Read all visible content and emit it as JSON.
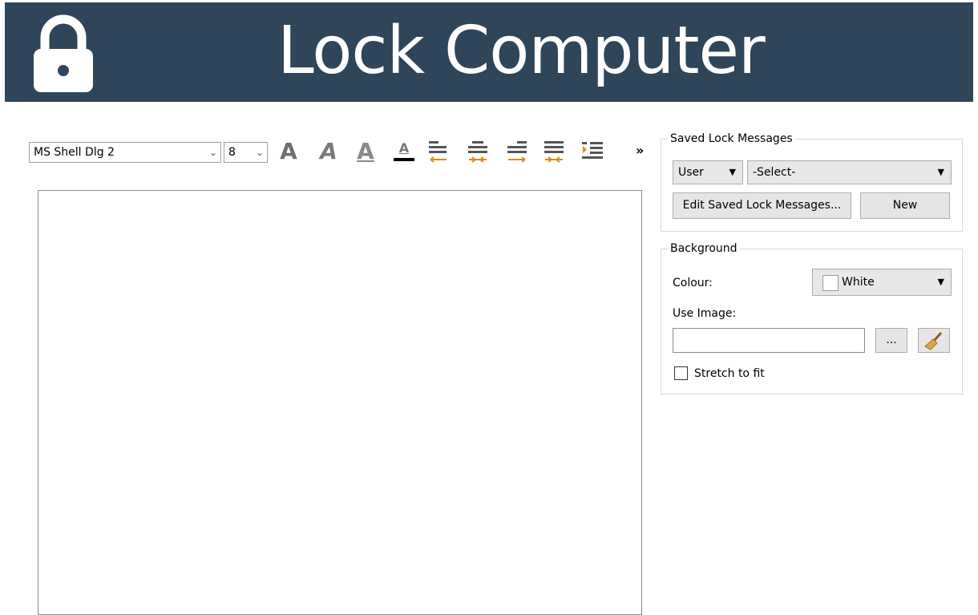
{
  "header": {
    "title": "Lock Computer",
    "icon": "lock-icon",
    "bg_color": "#2e455a"
  },
  "toolbar": {
    "font_family": "MS Shell Dlg 2",
    "font_size": "8",
    "overflow": "»",
    "icons": [
      "bold-icon",
      "italic-icon",
      "underline-icon",
      "font-color-icon",
      "align-left-icon",
      "align-center-icon",
      "align-right-icon",
      "justify-icon",
      "indent-icon"
    ],
    "letter": "A"
  },
  "saved": {
    "title": "Saved Lock Messages",
    "scope": "User",
    "selection": "-Select-",
    "edit_label": "Edit Saved Lock Messages...",
    "new_label": "New"
  },
  "background": {
    "title": "Background",
    "colour_label": "Colour:",
    "colour_value": "White",
    "image_label": "Use Image:",
    "image_value": "",
    "browse_label": "...",
    "stretch_label": "Stretch to fit",
    "stretch_checked": false
  },
  "editor": {
    "text": ""
  }
}
